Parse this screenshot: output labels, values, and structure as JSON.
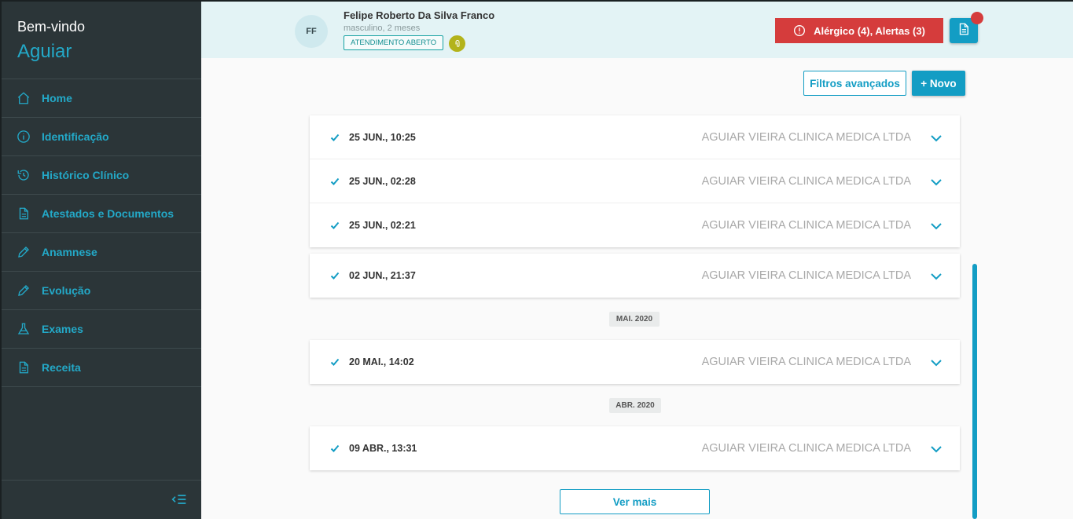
{
  "sidebar": {
    "welcome": "Bem-vindo",
    "user": "Aguiar",
    "items": [
      {
        "label": "Home",
        "icon": "home-icon"
      },
      {
        "label": "Identificação",
        "icon": "info-icon"
      },
      {
        "label": "Histórico Clínico",
        "icon": "history-icon"
      },
      {
        "label": "Atestados e Documentos",
        "icon": "document-icon"
      },
      {
        "label": "Anamnese",
        "icon": "pencil-icon"
      },
      {
        "label": "Evolução",
        "icon": "pencil-icon"
      },
      {
        "label": "Exames",
        "icon": "flask-icon"
      },
      {
        "label": "Receita",
        "icon": "document-icon"
      }
    ]
  },
  "header": {
    "initials": "FF",
    "patient_name": "Felipe Roberto Da Silva Franco",
    "patient_info": "masculino, 2 meses",
    "status_badge": "ATENDIMENTO ABERTO",
    "alert_label": "Alérgico (4),  Alertas (3)"
  },
  "toolbar": {
    "filter_label": "Filtros avançados",
    "new_label": "+ Novo"
  },
  "timeline": {
    "group1": [
      {
        "date": "25 JUN., 10:25",
        "org": "AGUIAR VIEIRA CLINICA MEDICA LTDA"
      },
      {
        "date": "25 JUN., 02:28",
        "org": "AGUIAR VIEIRA CLINICA MEDICA LTDA"
      },
      {
        "date": "25 JUN., 02:21",
        "org": "AGUIAR VIEIRA CLINICA MEDICA LTDA"
      }
    ],
    "group2": [
      {
        "date": "02 JUN., 21:37",
        "org": "AGUIAR VIEIRA CLINICA MEDICA LTDA"
      }
    ],
    "month_mai": "MAI. 2020",
    "group3": [
      {
        "date": "20 MAI., 14:02",
        "org": "AGUIAR VIEIRA CLINICA MEDICA LTDA"
      }
    ],
    "month_abr": "ABR. 2020",
    "group4": [
      {
        "date": "09 ABR., 13:31",
        "org": "AGUIAR VIEIRA CLINICA MEDICA LTDA"
      }
    ]
  },
  "more_label": "Ver mais",
  "colors": {
    "accent": "#139dc4",
    "sidebar_bg": "#2b3538",
    "alert": "#d53c3c",
    "header_bg": "#e3f3f5"
  }
}
